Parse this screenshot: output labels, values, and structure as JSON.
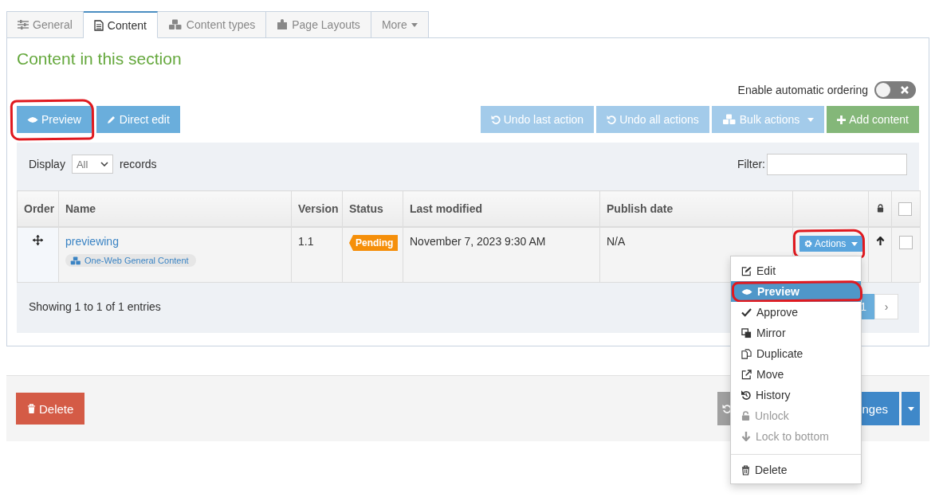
{
  "tabs": [
    {
      "label": "General",
      "selected": false
    },
    {
      "label": "Content",
      "selected": true
    },
    {
      "label": "Content types",
      "selected": false
    },
    {
      "label": "Page Layouts",
      "selected": false
    },
    {
      "label": "More",
      "selected": false
    }
  ],
  "heading": "Content in this section",
  "auto_ordering": {
    "label": "Enable automatic ordering",
    "on": false
  },
  "left_buttons": [
    {
      "label": "Preview",
      "highlighted": true
    },
    {
      "label": "Direct edit",
      "highlighted": false
    }
  ],
  "right_buttons": [
    {
      "label": "Undo last action",
      "kind": "light"
    },
    {
      "label": "Undo all actions",
      "kind": "light"
    },
    {
      "label": "Bulk actions",
      "kind": "dropdown"
    },
    {
      "label": "Add content",
      "kind": "success"
    }
  ],
  "display": {
    "label": "Display",
    "value": "All",
    "suffix": "records"
  },
  "filter": {
    "label": "Filter:"
  },
  "table": {
    "columns": [
      "Order",
      "Name",
      "Version",
      "Status",
      "Last modified",
      "Publish date"
    ],
    "header_checkbox": {
      "checked": false
    },
    "rows": [
      {
        "name": "previewing",
        "type": "One-Web General Content",
        "version": "1.1",
        "status": "Pending",
        "last_modified": "November 7, 2023 9:30 AM",
        "publish_date": "N/A",
        "actions": {
          "label": "Actions",
          "highlighted": true
        },
        "checked": false
      }
    ]
  },
  "summary": "Showing 1 to 1 of 1 entries",
  "pagination": [
    {
      "label": "1",
      "selected": true
    },
    {
      "label": "›",
      "selected": false
    }
  ],
  "footer": {
    "delete": "Delete",
    "save_visible": "nges"
  },
  "menu": {
    "items": [
      {
        "label": "Edit",
        "selected": false,
        "disabled": false,
        "highlighted": false
      },
      {
        "label": "Preview",
        "selected": true,
        "disabled": false,
        "highlighted": true
      },
      {
        "label": "Approve",
        "selected": false,
        "disabled": false,
        "highlighted": false
      },
      {
        "label": "Mirror",
        "selected": false,
        "disabled": false,
        "highlighted": false
      },
      {
        "label": "Duplicate",
        "selected": false,
        "disabled": false,
        "highlighted": false
      },
      {
        "label": "Move",
        "selected": false,
        "disabled": false,
        "highlighted": false
      },
      {
        "label": "History",
        "selected": false,
        "disabled": false,
        "highlighted": false
      },
      {
        "label": "Unlock",
        "selected": false,
        "disabled": true,
        "highlighted": false
      },
      {
        "label": "Lock to bottom",
        "selected": false,
        "disabled": true,
        "highlighted": false
      }
    ],
    "after_divider": [
      {
        "label": "Delete",
        "selected": false,
        "disabled": false,
        "highlighted": false
      }
    ]
  }
}
